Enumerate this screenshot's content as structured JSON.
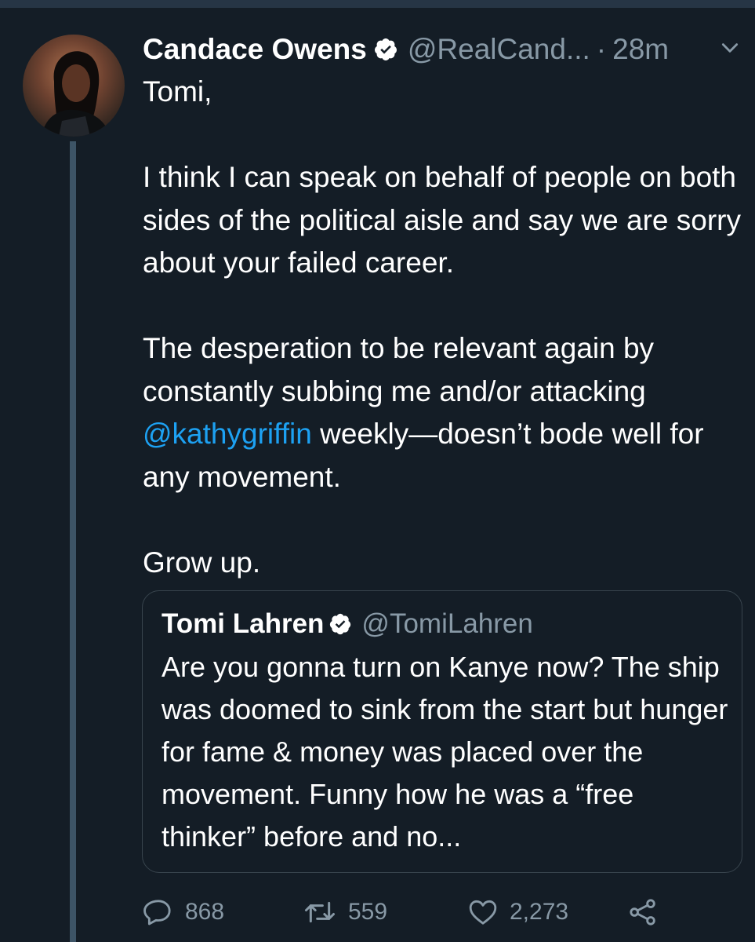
{
  "tweet": {
    "author": {
      "display_name": "Candace Owens",
      "handle": "@RealCand...",
      "verified": true
    },
    "separator": "·",
    "timestamp": "28m",
    "text": {
      "p1": "Tomi,",
      "p2": "I think I can speak on behalf of people on both sides of the political aisle and say we are sorry about your failed career.",
      "p3_before": "The desperation to be relevant again by constantly subbing me and/or attacking ",
      "p3_mention": "@kathygriffin",
      "p3_after": " weekly—doesn’t bode well for any movement.",
      "p4": "Grow up."
    },
    "quote": {
      "display_name": "Tomi Lahren",
      "handle": "@TomiLahren",
      "verified": true,
      "text": "Are you gonna turn on Kanye now? The ship was doomed to sink from the start but hunger for fame & money was placed over the movement. Funny how he was a “free thinker” before and no..."
    },
    "actions": {
      "reply_count": "868",
      "retweet_count": "559",
      "like_count": "2,273"
    }
  },
  "icons": {
    "verified": "verified-badge-icon",
    "chevron": "chevron-down-icon",
    "reply": "reply-icon",
    "retweet": "retweet-icon",
    "like": "heart-icon",
    "share": "share-icon"
  },
  "colors": {
    "background": "#141d26",
    "text": "#ffffff",
    "secondary_text": "#8899a6",
    "link": "#1da1f2",
    "border": "#38444d",
    "thread_line": "#3d5466"
  }
}
